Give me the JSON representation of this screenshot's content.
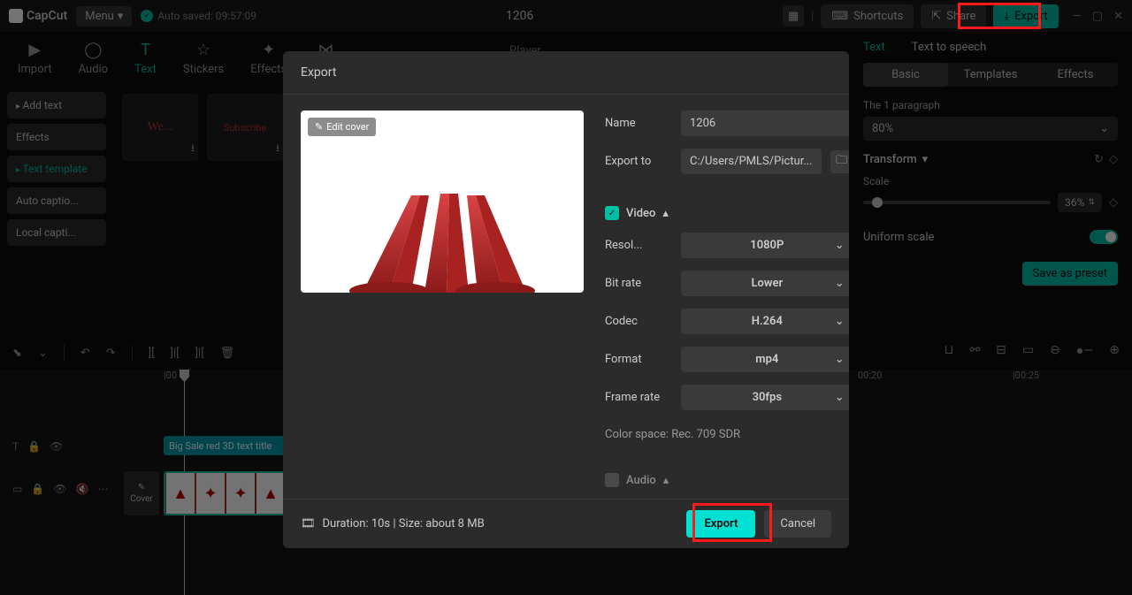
{
  "app": {
    "name": "CapCut",
    "menu_label": "Menu",
    "autosave": "Auto saved: 09:57:09",
    "project_title": "1206"
  },
  "topbar": {
    "shortcuts": "Shortcuts",
    "share": "Share",
    "export": "Export"
  },
  "tools": {
    "import": "Import",
    "audio": "Audio",
    "text": "Text",
    "stickers": "Stickers",
    "effects": "Effects",
    "transition": "Tra..."
  },
  "sidebar": {
    "add_text": "Add text",
    "effects": "Effects",
    "text_template": "Text template",
    "auto_captions": "Auto captio...",
    "local_captions": "Local capti..."
  },
  "player_label": "Player",
  "right": {
    "tab_text": "Text",
    "tab_tts": "Text to speech",
    "sub_basic": "Basic",
    "sub_templates": "Templates",
    "sub_effects": "Effects",
    "paragraph_label": "The 1 paragraph",
    "paragraph_val": "80%",
    "transform_label": "Transform",
    "scale_label": "Scale",
    "scale_val": "36%",
    "uniform_label": "Uniform scale",
    "save_preset": "Save as preset"
  },
  "timeline_ruler": {
    "t0": "|00",
    "t1": "00:20",
    "t2": "|00:25"
  },
  "clip": {
    "text_title": "Big Sale red 3D text title",
    "cover": "Cover"
  },
  "modal": {
    "title": "Export",
    "edit_cover": "Edit cover",
    "name_label": "Name",
    "name_value": "1206",
    "export_to_label": "Export to",
    "export_to_value": "C:/Users/PMLS/Pictur...",
    "video_label": "Video",
    "resolution_label": "Resol...",
    "resolution_value": "1080P",
    "bitrate_label": "Bit rate",
    "bitrate_value": "Lower",
    "codec_label": "Codec",
    "codec_value": "H.264",
    "format_label": "Format",
    "format_value": "mp4",
    "framerate_label": "Frame rate",
    "framerate_value": "30fps",
    "color_space": "Color space: Rec. 709 SDR",
    "audio_label": "Audio",
    "footer_info": "Duration: 10s | Size: about 8 MB",
    "export_btn": "Export",
    "cancel_btn": "Cancel"
  }
}
